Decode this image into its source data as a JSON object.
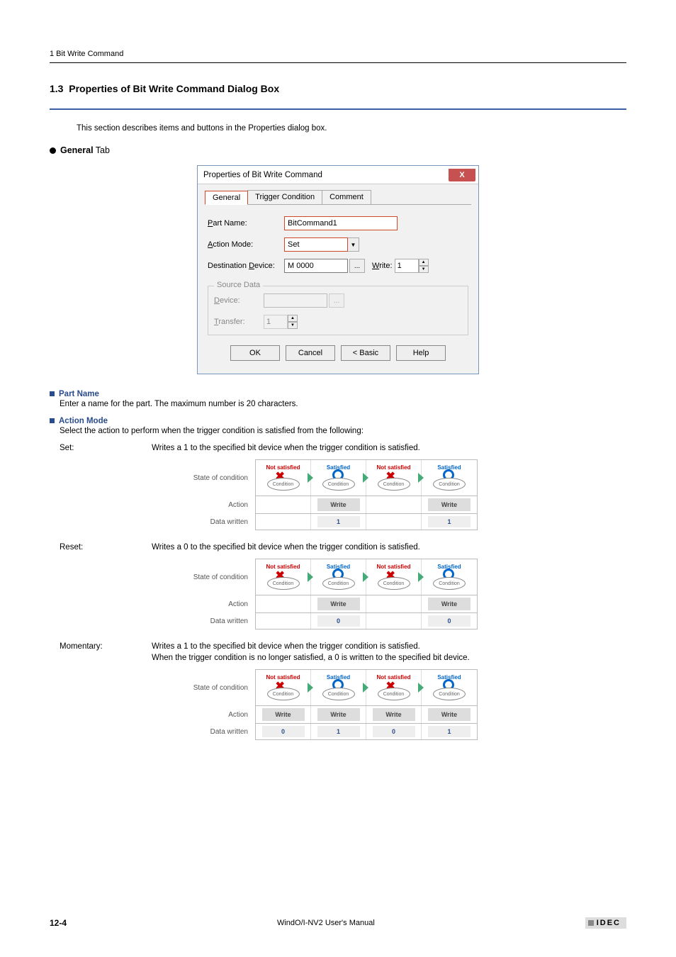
{
  "header": {
    "text": "1 Bit Write Command"
  },
  "section": {
    "number": "1.3",
    "title": "Properties of Bit Write Command Dialog Box",
    "intro": "This section describes items and buttons in the Properties dialog box.",
    "general_tab_label": "General",
    "tab_suffix": " Tab"
  },
  "dialog": {
    "title": "Properties of Bit Write Command",
    "close": "X",
    "tabs": {
      "general": "General",
      "trigger": "Trigger Condition",
      "comment": "Comment"
    },
    "part_name_label_prefix": "P",
    "part_name_label_rest": "art Name:",
    "part_name_value": "BitCommand1",
    "action_mode_label_prefix": "A",
    "action_mode_label_rest": "ction Mode:",
    "action_mode_value": "Set",
    "dest_device_label_prefix1": "Destination ",
    "dest_device_label_ul": "D",
    "dest_device_label_rest": "evice:",
    "dest_device_value": "M 0000",
    "ellipsis": "...",
    "write_label_ul": "W",
    "write_label_rest": "rite:",
    "write_value": "1",
    "source_data_title": "Source Data",
    "device_label_ul": "D",
    "device_label_rest": "evice:",
    "transfer_label_ul": "T",
    "transfer_label_rest": "ransfer:",
    "transfer_value": "1",
    "buttons": {
      "ok": "OK",
      "cancel": "Cancel",
      "basic": "< Basic",
      "help": "Help"
    }
  },
  "items": {
    "part_name_head": "Part Name",
    "part_name_desc": "Enter a name for the part. The maximum number is 20 characters.",
    "action_mode_head": "Action Mode",
    "action_mode_desc": "Select the action to perform when the trigger condition is satisfied from the following:"
  },
  "modes": {
    "set": {
      "term": "Set:",
      "desc": "Writes a 1 to the specified bit device when the trigger condition is satisfied."
    },
    "reset": {
      "term": "Reset:",
      "desc": "Writes a 0 to the specified bit device when the trigger condition is satisfied."
    },
    "momentary": {
      "term": "Momentary:",
      "desc1": "Writes a 1 to the specified bit device when the trigger condition is satisfied.",
      "desc2": "When the trigger condition is no longer satisfied, a 0 is written to the specified bit device."
    }
  },
  "diagram": {
    "row_state": "State of condition",
    "row_action": "Action",
    "row_data": "Data written",
    "not_satisfied": "Not satisfied",
    "satisfied": "Satisfied",
    "condition": "Condition",
    "write": "Write"
  },
  "chart_data": [
    {
      "type": "table",
      "title": "Set mode timing",
      "columns": [
        "Not satisfied",
        "Satisfied",
        "Not satisfied",
        "Satisfied"
      ],
      "action": [
        "",
        "Write",
        "",
        "Write"
      ],
      "data_written": [
        "",
        "1",
        "",
        "1"
      ]
    },
    {
      "type": "table",
      "title": "Reset mode timing",
      "columns": [
        "Not satisfied",
        "Satisfied",
        "Not satisfied",
        "Satisfied"
      ],
      "action": [
        "",
        "Write",
        "",
        "Write"
      ],
      "data_written": [
        "",
        "0",
        "",
        "0"
      ]
    },
    {
      "type": "table",
      "title": "Momentary mode timing",
      "columns": [
        "Not satisfied",
        "Satisfied",
        "Not satisfied",
        "Satisfied"
      ],
      "action": [
        "Write",
        "Write",
        "Write",
        "Write"
      ],
      "data_written": [
        "0",
        "1",
        "0",
        "1"
      ]
    }
  ],
  "footer": {
    "page": "12-4",
    "center": "WindO/I-NV2 User's Manual",
    "brand": "IDEC"
  }
}
